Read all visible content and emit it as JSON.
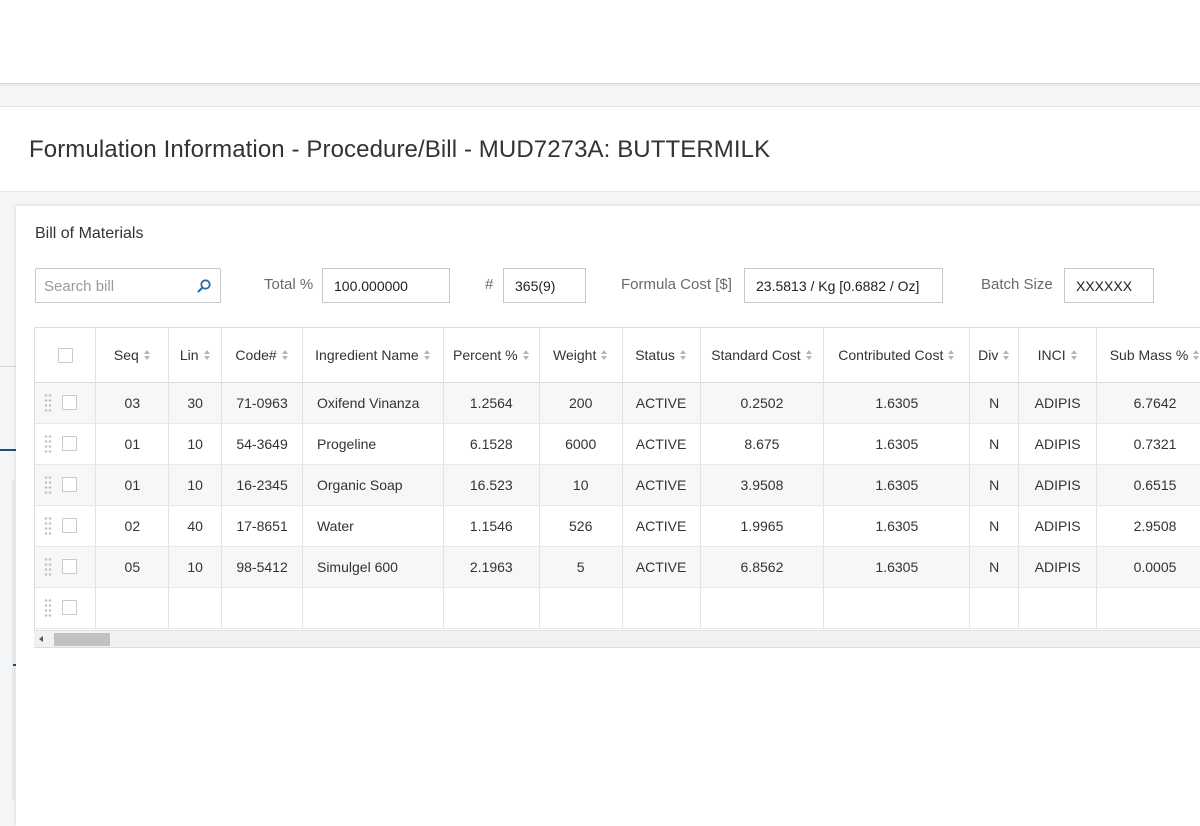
{
  "page": {
    "title": "Formulation Information - Procedure/Bill - MUD7273A: BUTTERMILK"
  },
  "card": {
    "title": "Bill of Materials"
  },
  "toolbar": {
    "search_placeholder": "Search bill",
    "total_label": "Total %",
    "total_value": "100.000000",
    "hash_label": "#",
    "hash_value": "365(9)",
    "formula_cost_label": "Formula Cost [$]",
    "formula_cost_value": "23.5813 / Kg [0.6882 / Oz]",
    "batch_size_label": "Batch Size",
    "batch_size_value": "XXXXXX"
  },
  "table": {
    "columns": [
      "Seq",
      "Lin",
      "Code#",
      "Ingredient Name",
      "Percent %",
      "Weight",
      "Status",
      "Standard Cost",
      "Contributed Cost",
      "Div",
      "INCI",
      "Sub Mass %"
    ],
    "rows": [
      [
        "03",
        "30",
        "71-0963",
        "Oxifend Vinanza",
        "1.2564",
        "200",
        "ACTIVE",
        "0.2502",
        "1.6305",
        "N",
        "ADIPIS",
        "6.7642"
      ],
      [
        "01",
        "10",
        "54-3649",
        "Progeline",
        "6.1528",
        "6000",
        "ACTIVE",
        "8.675",
        "1.6305",
        "N",
        "ADIPIS",
        "0.7321"
      ],
      [
        "01",
        "10",
        "16-2345",
        "Organic Soap",
        "16.523",
        "10",
        "ACTIVE",
        "3.9508",
        "1.6305",
        "N",
        "ADIPIS",
        "0.6515"
      ],
      [
        "02",
        "40",
        "17-8651",
        "Water",
        "1.1546",
        "526",
        "ACTIVE",
        "1.9965",
        "1.6305",
        "N",
        "ADIPIS",
        "2.9508"
      ],
      [
        "05",
        "10",
        "98-5412",
        "Simulgel 600",
        "2.1963",
        "5",
        "ACTIVE",
        "6.8562",
        "1.6305",
        "N",
        "ADIPIS",
        "0.0005"
      ]
    ]
  },
  "icons": {
    "search": "search-icon",
    "drag": "drag-handle-icon",
    "sort": "sort-icon",
    "scroll_left": "scroll-left-icon"
  },
  "colors": {
    "accent": "#1d4f7c",
    "row_alt": "#f7f7f7",
    "border": "#dcdcdc"
  }
}
